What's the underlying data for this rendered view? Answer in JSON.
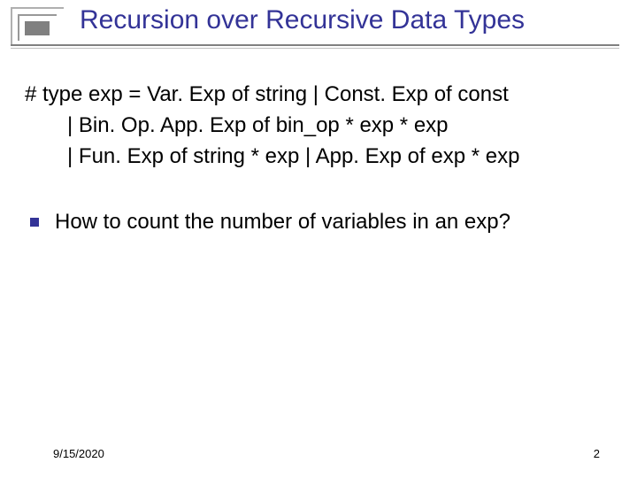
{
  "title": "Recursion over Recursive Data Types",
  "type_def": {
    "line1": "# type exp = Var. Exp of string | Const. Exp of const",
    "line2": "| Bin. Op. App. Exp of bin_op * exp * exp",
    "line3": "| Fun. Exp of string * exp | App. Exp of exp * exp"
  },
  "bullet": "How to count the number of variables in an exp?",
  "footer": {
    "date": "9/15/2020",
    "page": "2"
  }
}
